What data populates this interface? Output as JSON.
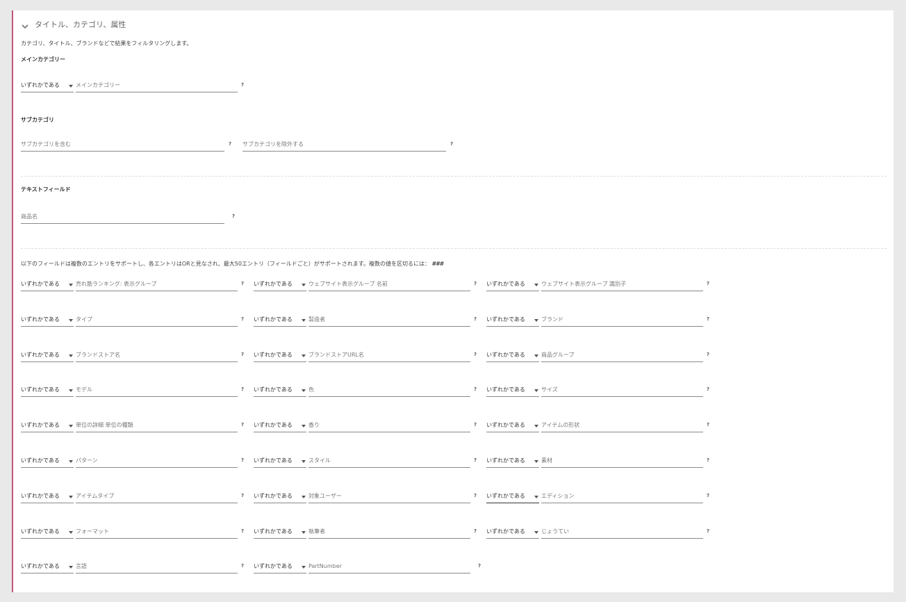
{
  "section": {
    "title": "タイトル、カテゴリ、属性",
    "description": "カテゴリ、タイトル、ブランドなどで結果をフィルタリングします。"
  },
  "main_category": {
    "title": "メインカテゴリー",
    "operator": "いずれかである",
    "placeholder": "メインカテゴリー",
    "help": "?"
  },
  "subcategory": {
    "title": "サブカテゴリ",
    "include_placeholder": "サブカテゴリを含む",
    "exclude_placeholder": "サブカテゴリを除外する",
    "help": "?"
  },
  "text_fields": {
    "title": "テキストフィールド",
    "product_name_placeholder": "商品名",
    "help": "?"
  },
  "multi": {
    "note_prefix": "以下のフィールドは複数のエントリをサポートし、各エントリはORと見なされ、最大50エントリ（フィールドごと）がサポートされます。複数の値を区切るには：",
    "note_sep": "###",
    "operator_label": "いずれかである",
    "help": "?",
    "rows": [
      [
        "売れ筋ランキング: 表示グループ",
        "ウェブサイト表示グループ 名前",
        "ウェブサイト表示グループ 識別子"
      ],
      [
        "タイプ",
        "製造者",
        "ブランド"
      ],
      [
        "ブランドストア名",
        "ブランドストアURL名",
        "商品グループ"
      ],
      [
        "モデル",
        "色",
        "サイズ"
      ],
      [
        "単位の詳細 単位の種類",
        "香り",
        "アイテムの形状"
      ],
      [
        "パターン",
        "スタイル",
        "素材"
      ],
      [
        "アイテムタイプ",
        "対象ユーザー",
        "エディション"
      ],
      [
        "フォーマット",
        "執筆者",
        "じょうてい"
      ],
      [
        "言語",
        "PartNumber"
      ]
    ]
  }
}
